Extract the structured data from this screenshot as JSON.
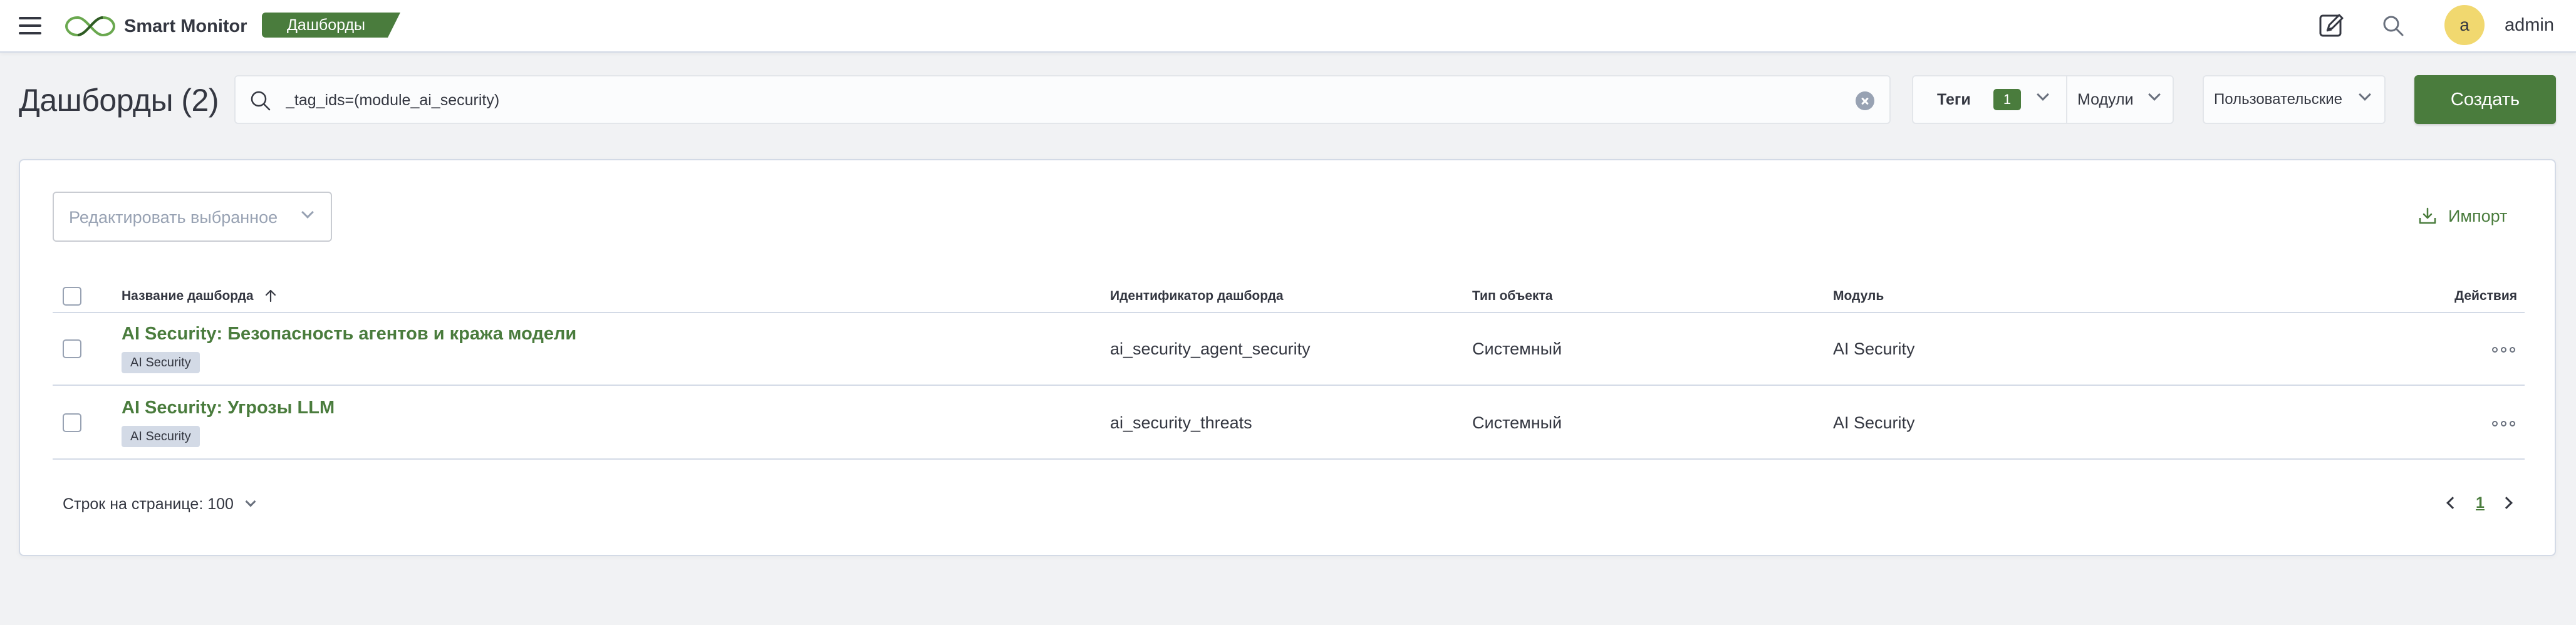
{
  "header": {
    "app_name": "Smart Monitor",
    "breadcrumb": "Дашборды",
    "avatar_initial": "a",
    "user_name": "admin",
    "icons": [
      "menu-icon",
      "logo-icon",
      "edit-icon",
      "search-icon"
    ]
  },
  "page": {
    "title": "Дашборды (2)",
    "search": {
      "value": "_tag_ids=(module_ai_security)",
      "placeholder": ""
    },
    "filters": {
      "tags_label": "Теги",
      "tags_count": "1",
      "modules_label": "Модули",
      "type_label": "Пользовательские"
    },
    "create_label": "Создать"
  },
  "panel": {
    "bulk_edit_label": "Редактировать выбранное",
    "import_label": "Импорт",
    "columns": {
      "name": "Название дашборда",
      "id": "Идентификатор дашборда",
      "type": "Тип объекта",
      "module": "Модуль",
      "actions": "Действия"
    },
    "sort": {
      "column": "name",
      "direction": "ascending"
    },
    "rows": [
      {
        "title": "AI Security: Безопасность агентов и кража модели",
        "tag": "AI Security",
        "id": "ai_security_agent_security",
        "type": "Системный",
        "module": "AI Security"
      },
      {
        "title": "AI Security: Угрозы LLM",
        "tag": "AI Security",
        "id": "ai_security_threats",
        "type": "Системный",
        "module": "AI Security"
      }
    ],
    "rows_per_page_label": "Строк на странице: 100",
    "current_page": "1"
  },
  "colors": {
    "accent": "#4a7c3d",
    "background": "#f1f2f4",
    "avatar": "#f1d86f",
    "tag_badge": "#d3dae6"
  }
}
